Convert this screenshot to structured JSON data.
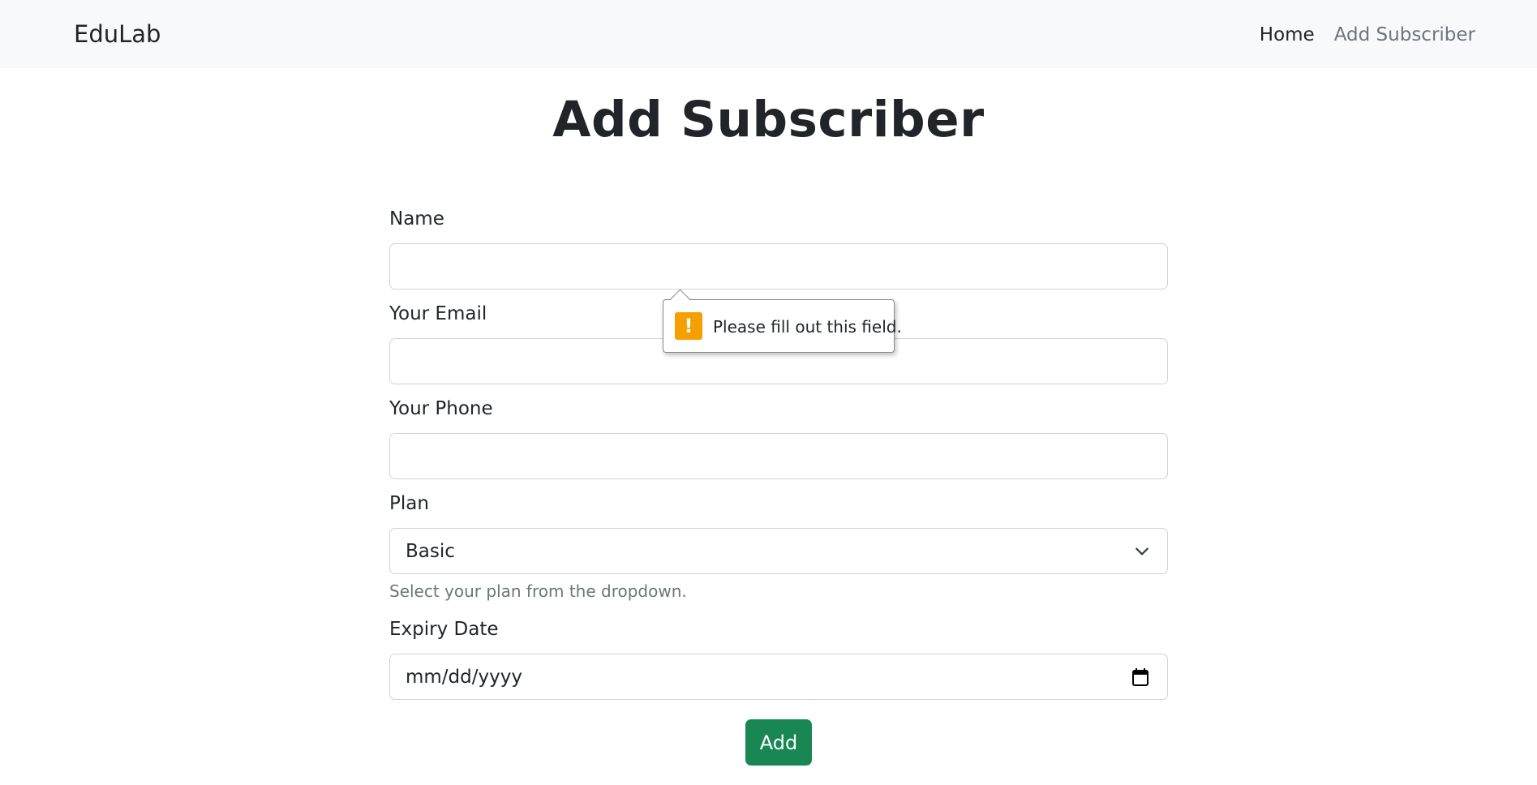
{
  "navbar": {
    "brand": "EduLab",
    "links": [
      "Home",
      "Add Subscriber"
    ]
  },
  "page": {
    "title": "Add Subscriber"
  },
  "form": {
    "name_label": "Name",
    "email_label": "Your Email",
    "phone_label": "Your Phone",
    "plan_label": "Plan",
    "plan_value": "Basic",
    "plan_help": "Select your plan from the dropdown.",
    "expiry_label": "Expiry Date",
    "expiry_placeholder": "mm/dd/yyyy",
    "submit_label": "Add"
  },
  "validation": {
    "message": "Please fill out this field.",
    "icon": "warning-icon"
  },
  "colors": {
    "navbar_bg": "#f8f9fa",
    "submit_bg": "#198754",
    "warning": "#f5a000",
    "muted": "#6c757d"
  }
}
